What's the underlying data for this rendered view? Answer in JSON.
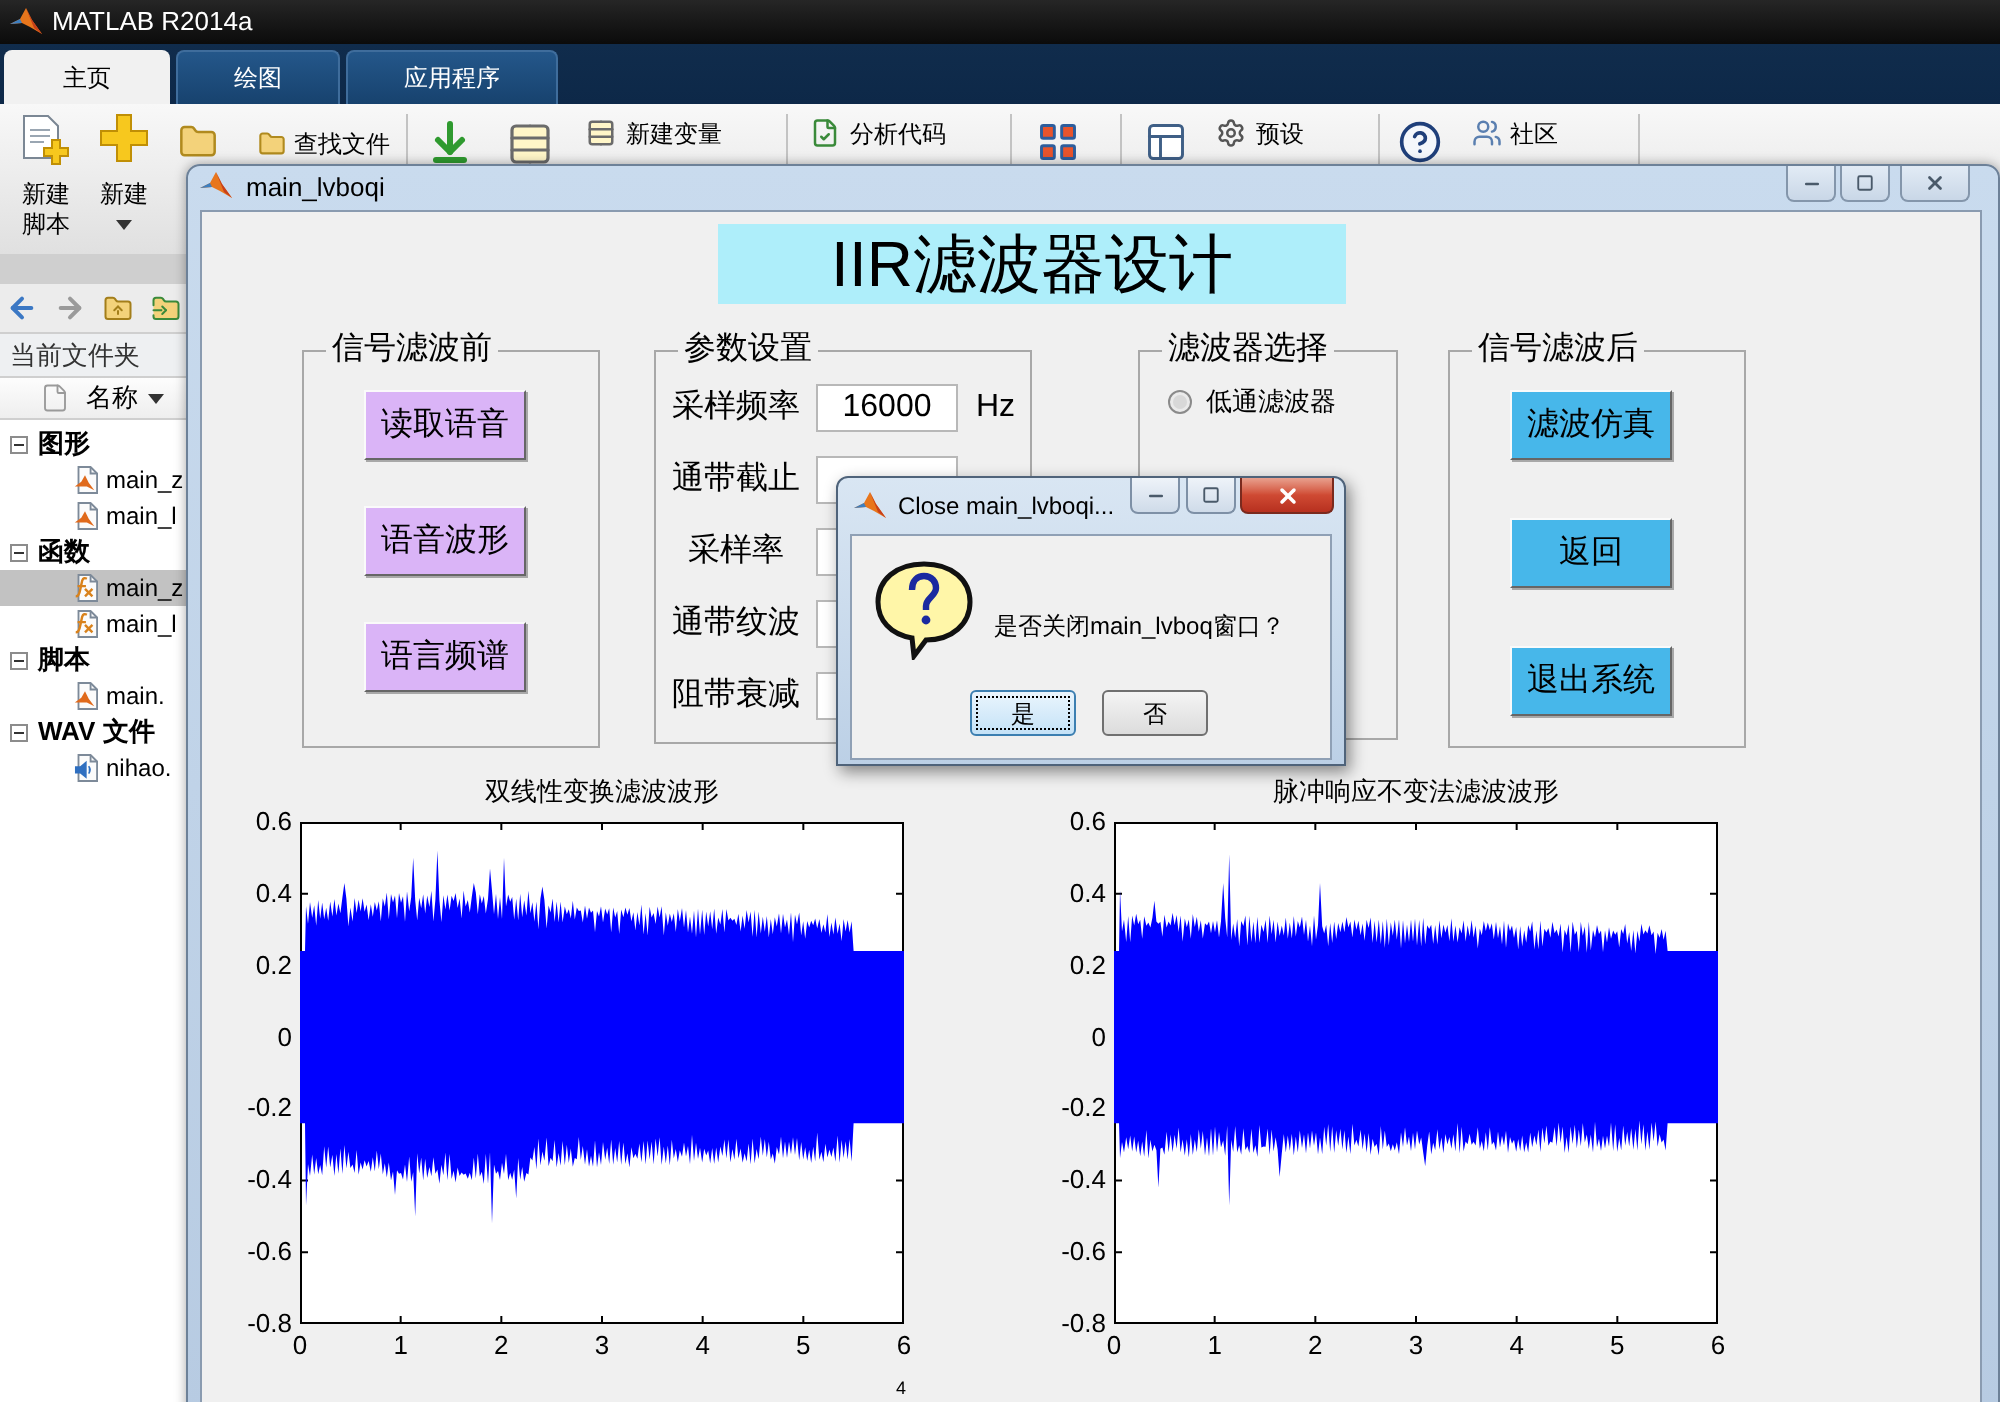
{
  "app": {
    "title": "MATLAB R2014a"
  },
  "ribbon_tabs": [
    {
      "label": "主页",
      "selected": true
    },
    {
      "label": "绘图",
      "selected": false
    },
    {
      "label": "应用程序",
      "selected": false
    }
  ],
  "toolstrip": {
    "new_script_label": [
      "新建",
      "脚本"
    ],
    "new_label": "新建",
    "find_files": "查找文件",
    "new_variable": "新建变量",
    "analyze_code": "分析代码",
    "preferences": "预设",
    "community": "社区"
  },
  "current_folder": {
    "title": "当前文件夹",
    "column": "名称",
    "tree": [
      {
        "label": "图形",
        "expanded": true,
        "children": [
          {
            "name": "main_z",
            "kind": "figure",
            "selected": false
          },
          {
            "name": "main_l",
            "kind": "figure",
            "selected": false
          }
        ]
      },
      {
        "label": "函数",
        "expanded": true,
        "children": [
          {
            "name": "main_z",
            "kind": "function",
            "selected": true
          },
          {
            "name": "main_l",
            "kind": "function",
            "selected": false
          }
        ]
      },
      {
        "label": "脚本",
        "expanded": true,
        "children": [
          {
            "name": "main.",
            "kind": "script",
            "selected": false
          }
        ]
      },
      {
        "label": "WAV 文件",
        "expanded": true,
        "children": [
          {
            "name": "nihao.",
            "kind": "audio",
            "selected": false
          }
        ]
      }
    ]
  },
  "figure_window": {
    "title": "main_lvboqi",
    "heading": "IIR滤波器设计",
    "groups": [
      {
        "kind": "buttons",
        "title": "信号滤波前",
        "color": "#dab4f7",
        "buttons": [
          "读取语音",
          "语音波形",
          "语言频谱"
        ]
      },
      {
        "kind": "params",
        "title": "参数设置",
        "rows": [
          {
            "label": "采样频率",
            "value": "16000",
            "unit": "Hz"
          },
          {
            "label": "通带截止"
          },
          {
            "label": "采样率"
          },
          {
            "label": "通带纹波"
          },
          {
            "label": "阻带衰减"
          }
        ]
      },
      {
        "kind": "radios",
        "title": "滤波器选择",
        "options": [
          {
            "label": "低通滤波器",
            "selected": false
          }
        ]
      },
      {
        "kind": "buttons",
        "title": "信号滤波后",
        "color": "#47b7ea",
        "buttons": [
          "滤波仿真",
          "返回",
          "退出系统"
        ]
      }
    ],
    "charts": [
      {
        "title": "双线性变换滤波波形",
        "y_ticks": [
          "0.6",
          "0.4",
          "0.2",
          "0",
          "-0.2",
          "-0.4",
          "-0.6",
          "-0.8"
        ],
        "x_ticks": [
          "0",
          "1",
          "2",
          "3",
          "4",
          "5",
          "6"
        ],
        "x_exponent": "4"
      },
      {
        "title": "脉冲响应不变法滤波波形",
        "y_ticks": [
          "0.6",
          "0.4",
          "0.2",
          "0",
          "-0.2",
          "-0.4",
          "-0.6",
          "-0.8"
        ],
        "x_ticks": [
          "0",
          "1",
          "2",
          "3",
          "4",
          "5",
          "6"
        ]
      }
    ]
  },
  "dialog": {
    "title": "Close main_lvboqi...",
    "message": "是否关闭main_lvboq窗口？",
    "buttons": [
      {
        "label": "是",
        "focused": true
      },
      {
        "label": "否",
        "focused": false
      }
    ]
  }
}
